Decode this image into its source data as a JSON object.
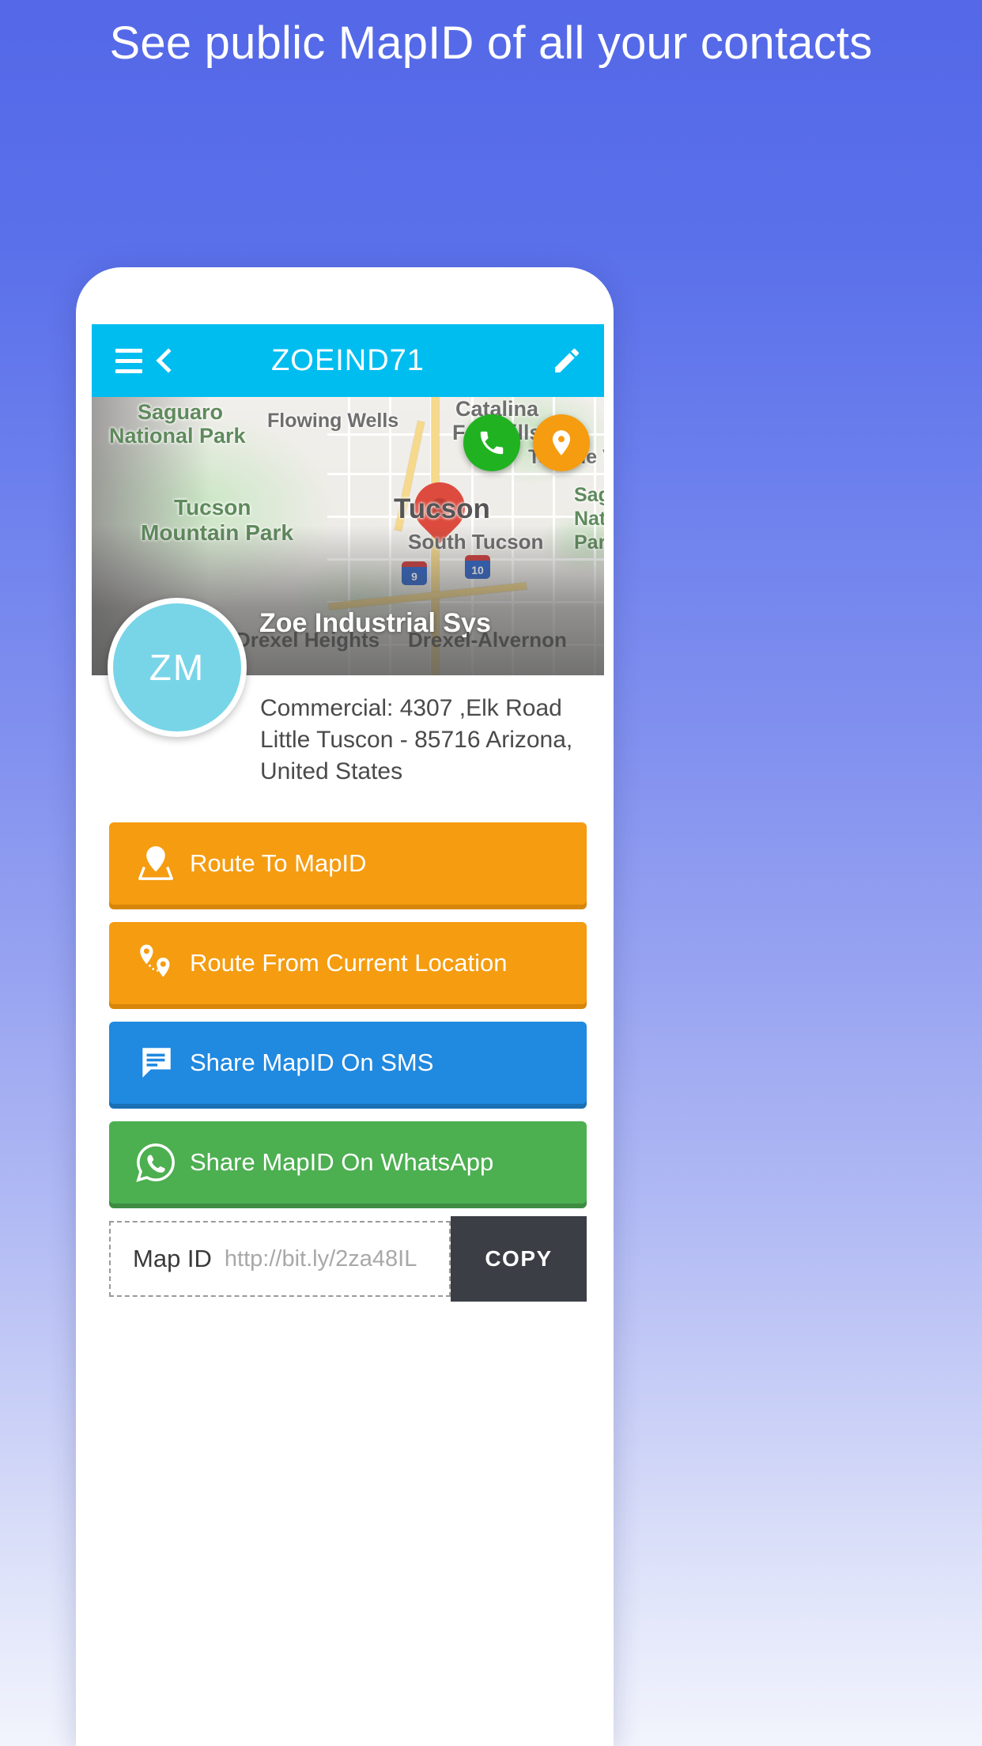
{
  "headline": "See public MapID of all your contacts",
  "appbar": {
    "menu_icon": "hamburger-menu-icon",
    "back_icon": "back-chevron-icon",
    "title": "ZOEIND71",
    "edit_icon": "edit-pencil-icon"
  },
  "map": {
    "labels": [
      {
        "text": "Saguaro",
        "kind": "park"
      },
      {
        "text": "National Park",
        "kind": "park"
      },
      {
        "text": "Flowing Wells",
        "kind": "city"
      },
      {
        "text": "Catalina",
        "kind": "city"
      },
      {
        "text": "Foothills",
        "kind": "city"
      },
      {
        "text": "Tucson",
        "kind": "park"
      },
      {
        "text": "Mountain Park",
        "kind": "park"
      },
      {
        "text": "Tucson",
        "kind": "city"
      },
      {
        "text": "South Tucson",
        "kind": "city"
      },
      {
        "text": "Tanque Verd",
        "kind": "city"
      },
      {
        "text": "Sag",
        "kind": "park"
      },
      {
        "text": "Nat",
        "kind": "park"
      },
      {
        "text": "Parl",
        "kind": "park"
      },
      {
        "text": "Drexel Heights",
        "kind": "city"
      },
      {
        "text": "Drexel-Alvernon",
        "kind": "city"
      }
    ],
    "highway_shields": [
      "9",
      "10"
    ],
    "marker_icon": "map-marker-pin-icon",
    "call_fab_icon": "phone-icon",
    "location_fab_icon": "location-pin-icon",
    "call_fab_color": "#21b221",
    "location_fab_color": "#f59c10",
    "place_name": "Zoe Industrial Sys"
  },
  "contact": {
    "avatar_initials": "ZM",
    "avatar_color": "#78d5e8",
    "address_lines": [
      "Commercial: 4307 ,Elk Road",
      "Little Tuscon - 85716 Arizona,",
      "United States"
    ]
  },
  "actions": [
    {
      "label": "Route To MapID",
      "icon": "map-pin-route-icon",
      "style": "orange",
      "color": "#f59c10"
    },
    {
      "label": "Route From Current Location",
      "icon": "two-pins-route-icon",
      "style": "orange",
      "color": "#f59c10"
    },
    {
      "label": "Share MapID On SMS",
      "icon": "sms-message-icon",
      "style": "blue",
      "color": "#2089e0"
    },
    {
      "label": "Share MapID On WhatsApp",
      "icon": "whatsapp-icon",
      "style": "green",
      "color": "#4caf50"
    }
  ],
  "mapid": {
    "label": "Map ID",
    "placeholder": "http://bit.ly/2za48IL",
    "copy_label": "COPY"
  },
  "colors": {
    "appbar": "#00bdf0",
    "background_top": "#5468e8",
    "copy_button": "#3b3f45"
  }
}
